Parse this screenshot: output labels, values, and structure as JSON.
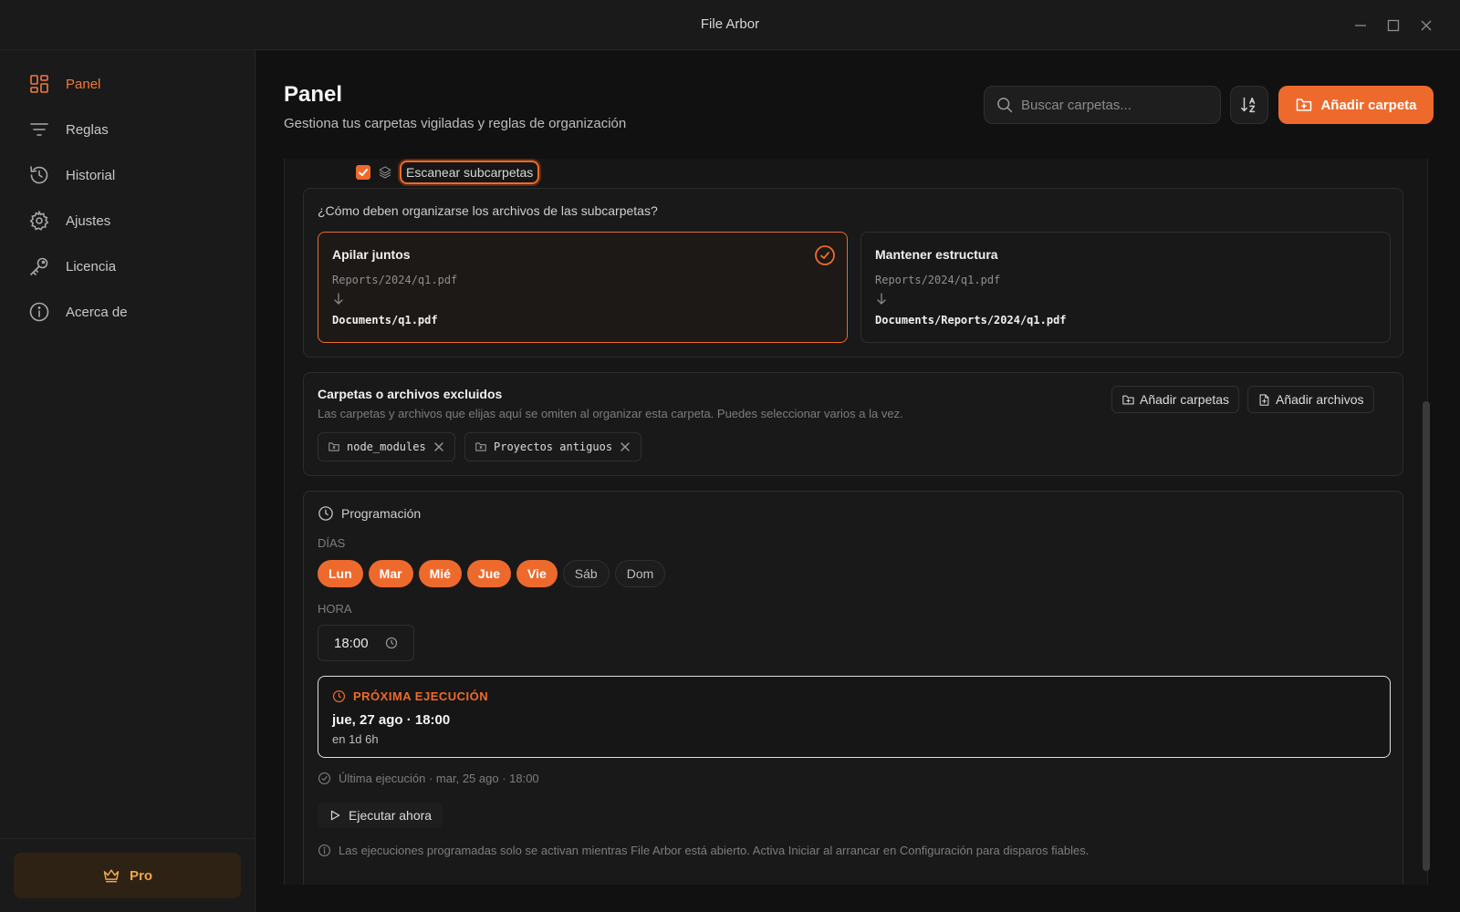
{
  "window": {
    "title": "File Arbor"
  },
  "sidebar": {
    "items": [
      {
        "label": "Panel",
        "icon": "dashboard-icon",
        "active": true
      },
      {
        "label": "Reglas",
        "icon": "filter-icon",
        "active": false
      },
      {
        "label": "Historial",
        "icon": "history-icon",
        "active": false
      },
      {
        "label": "Ajustes",
        "icon": "gear-icon",
        "active": false
      },
      {
        "label": "Licencia",
        "icon": "key-icon",
        "active": false
      },
      {
        "label": "Acerca de",
        "icon": "info-icon",
        "active": false
      }
    ],
    "pro_label": "Pro"
  },
  "header": {
    "title": "Panel",
    "subtitle": "Gestiona tus carpetas vigiladas y reglas de organización",
    "search_placeholder": "Buscar carpetas...",
    "add_label": "Añadir carpeta"
  },
  "scan": {
    "label": "Escanear subcarpetas",
    "checked": true
  },
  "subfolders": {
    "question": "¿Cómo deben organizarse los archivos de las subcarpetas?",
    "options": [
      {
        "title": "Apilar juntos",
        "from": "Reports/2024/q1.pdf",
        "to": "Documents/q1.pdf",
        "selected": true
      },
      {
        "title": "Mantener estructura",
        "from": "Reports/2024/q1.pdf",
        "to": "Documents/Reports/2024/q1.pdf",
        "selected": false
      }
    ]
  },
  "excluded": {
    "title": "Carpetas o archivos excluidos",
    "subtitle": "Las carpetas y archivos que elijas aquí se omiten al organizar esta carpeta. Puedes seleccionar varios a la vez.",
    "add_folders": "Añadir carpetas",
    "add_files": "Añadir archivos",
    "items": [
      "node_modules",
      "Proyectos antiguos"
    ]
  },
  "schedule": {
    "title": "Programación",
    "days_label": "DÍAS",
    "days": [
      {
        "label": "Lun",
        "on": true
      },
      {
        "label": "Mar",
        "on": true
      },
      {
        "label": "Mié",
        "on": true
      },
      {
        "label": "Jue",
        "on": true
      },
      {
        "label": "Vie",
        "on": true
      },
      {
        "label": "Sáb",
        "on": false
      },
      {
        "label": "Dom",
        "on": false
      }
    ],
    "time_label": "HORA",
    "time": "18:00",
    "next_label": "PRÓXIMA EJECUCIÓN",
    "next_date": "jue, 27 ago · 18:00",
    "next_rel": "en 1d 6h",
    "last_run": "Última ejecución · mar, 25 ago · 18:00",
    "run_now": "Ejecutar ahora",
    "note": "Las ejecuciones programadas solo se activan mientras File Arbor está abierto. Activa Iniciar al arrancar en Configuración para disparos fiables."
  },
  "colors": {
    "accent": "#ee6a2c",
    "pro": "#f4a64a"
  }
}
